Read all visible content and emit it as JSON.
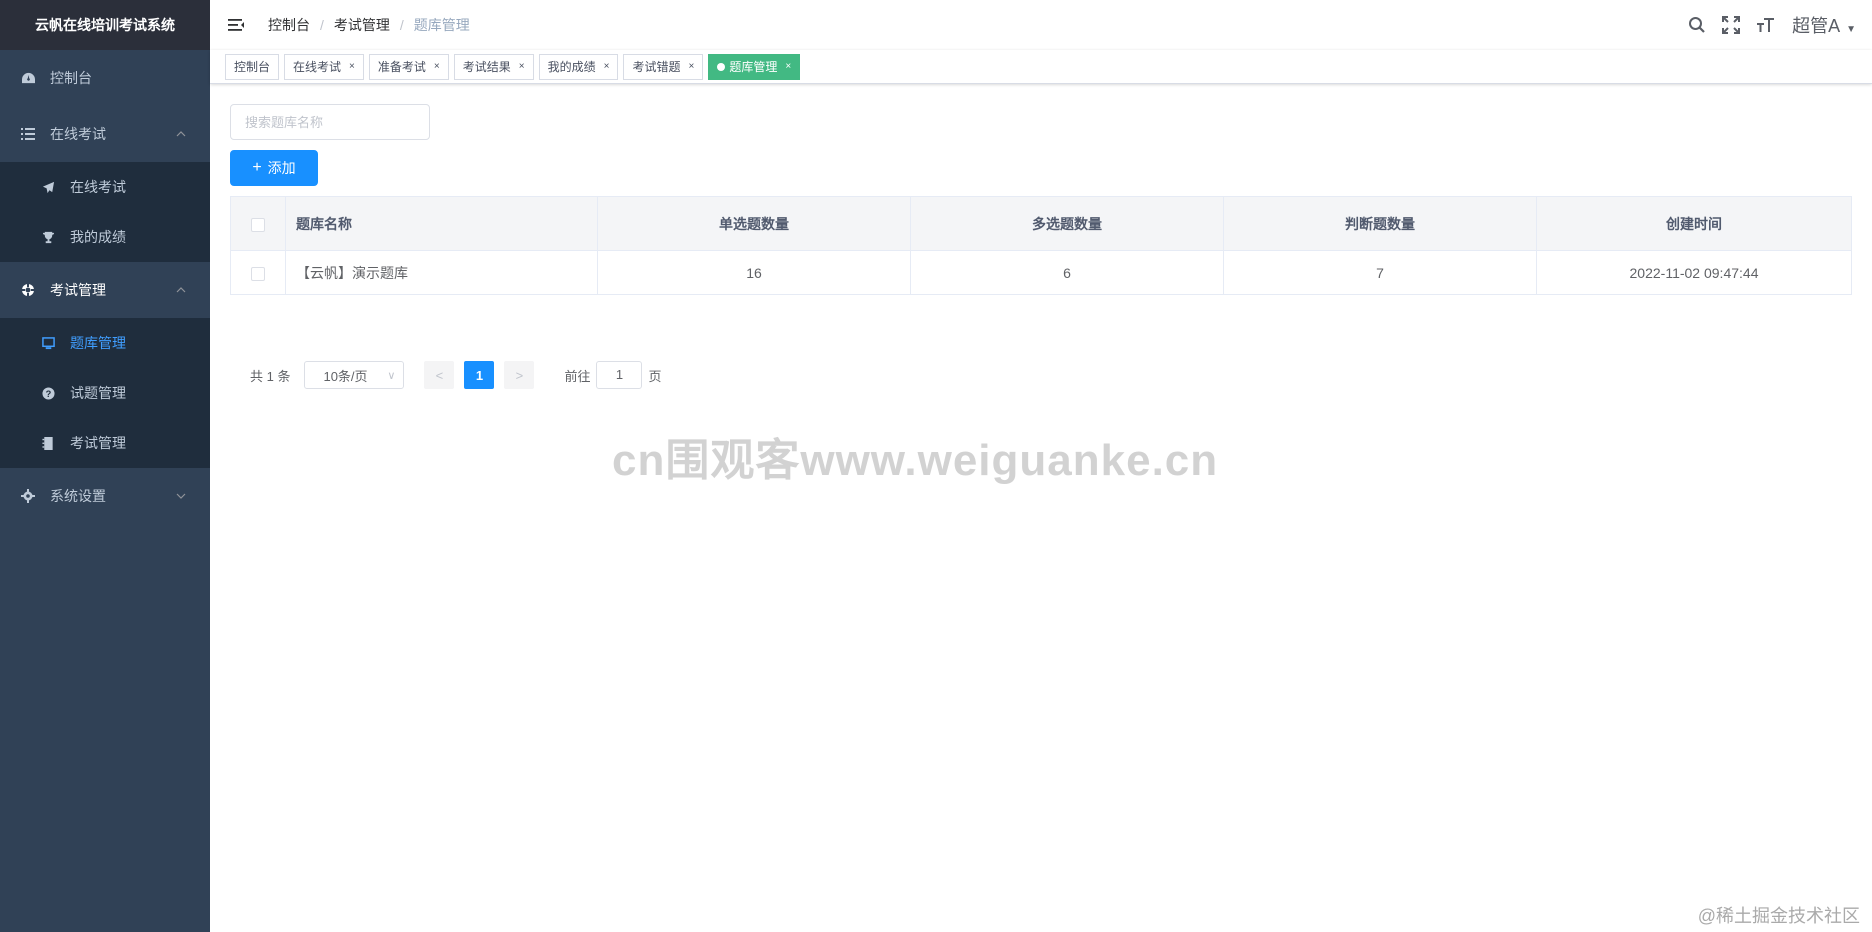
{
  "app": {
    "title": "云帆在线培训考试系统"
  },
  "sidebar": {
    "items": [
      {
        "label": "控制台",
        "icon": "dashboard-icon"
      },
      {
        "label": "在线考试",
        "icon": "list-icon",
        "expanded": true,
        "children": [
          {
            "label": "在线考试",
            "icon": "paper-plane-icon"
          },
          {
            "label": "我的成绩",
            "icon": "trophy-icon"
          }
        ]
      },
      {
        "label": "考试管理",
        "icon": "lifebuoy-icon",
        "expanded": true,
        "children": [
          {
            "label": "题库管理",
            "icon": "monitor-icon",
            "active": true
          },
          {
            "label": "试题管理",
            "icon": "question-icon"
          },
          {
            "label": "考试管理",
            "icon": "book-icon"
          }
        ]
      },
      {
        "label": "系统设置",
        "icon": "gear-icon",
        "expanded": false
      }
    ]
  },
  "header": {
    "breadcrumb": [
      "控制台",
      "考试管理",
      "题库管理"
    ],
    "user": "超管A"
  },
  "tags": [
    {
      "label": "控制台",
      "closable": false
    },
    {
      "label": "在线考试",
      "closable": true
    },
    {
      "label": "准备考试",
      "closable": true
    },
    {
      "label": "考试结果",
      "closable": true
    },
    {
      "label": "我的成绩",
      "closable": true
    },
    {
      "label": "考试错题",
      "closable": true
    },
    {
      "label": "题库管理",
      "closable": true,
      "active": true
    }
  ],
  "tag_close": "×",
  "search": {
    "placeholder": "搜索题库名称"
  },
  "add_button": {
    "label": "添加"
  },
  "table": {
    "headers": [
      "题库名称",
      "单选题数量",
      "多选题数量",
      "判断题数量",
      "创建时间"
    ],
    "rows": [
      [
        "【云帆】演示题库",
        "16",
        "6",
        "7",
        "2022-11-02 09:47:44"
      ]
    ]
  },
  "pagination": {
    "total": "共 1 条",
    "page_size": "10条/页",
    "current": "1",
    "goto_prefix": "前往",
    "goto_value": "1",
    "goto_suffix": "页"
  },
  "watermark": "cn围观客www.weiguanke.cn",
  "footer_watermark": "@稀土掘金技术社区",
  "colors": {
    "sidebar": "#304156",
    "primary": "#1890ff",
    "active_tag": "#42b983"
  }
}
